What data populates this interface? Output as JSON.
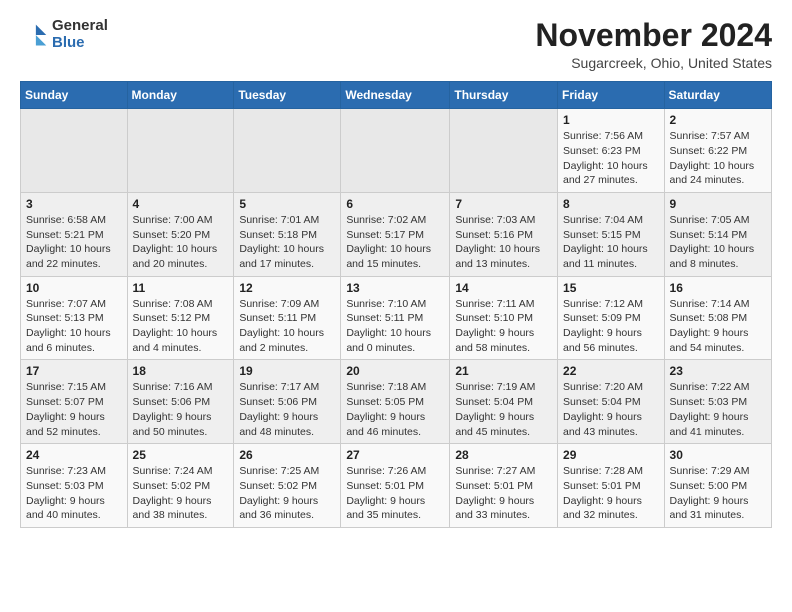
{
  "header": {
    "logo_general": "General",
    "logo_blue": "Blue",
    "month_title": "November 2024",
    "location": "Sugarcreek, Ohio, United States"
  },
  "days_of_week": [
    "Sunday",
    "Monday",
    "Tuesday",
    "Wednesday",
    "Thursday",
    "Friday",
    "Saturday"
  ],
  "weeks": [
    [
      {
        "day": "",
        "detail": ""
      },
      {
        "day": "",
        "detail": ""
      },
      {
        "day": "",
        "detail": ""
      },
      {
        "day": "",
        "detail": ""
      },
      {
        "day": "",
        "detail": ""
      },
      {
        "day": "1",
        "detail": "Sunrise: 7:56 AM\nSunset: 6:23 PM\nDaylight: 10 hours and 27 minutes."
      },
      {
        "day": "2",
        "detail": "Sunrise: 7:57 AM\nSunset: 6:22 PM\nDaylight: 10 hours and 24 minutes."
      }
    ],
    [
      {
        "day": "3",
        "detail": "Sunrise: 6:58 AM\nSunset: 5:21 PM\nDaylight: 10 hours and 22 minutes."
      },
      {
        "day": "4",
        "detail": "Sunrise: 7:00 AM\nSunset: 5:20 PM\nDaylight: 10 hours and 20 minutes."
      },
      {
        "day": "5",
        "detail": "Sunrise: 7:01 AM\nSunset: 5:18 PM\nDaylight: 10 hours and 17 minutes."
      },
      {
        "day": "6",
        "detail": "Sunrise: 7:02 AM\nSunset: 5:17 PM\nDaylight: 10 hours and 15 minutes."
      },
      {
        "day": "7",
        "detail": "Sunrise: 7:03 AM\nSunset: 5:16 PM\nDaylight: 10 hours and 13 minutes."
      },
      {
        "day": "8",
        "detail": "Sunrise: 7:04 AM\nSunset: 5:15 PM\nDaylight: 10 hours and 11 minutes."
      },
      {
        "day": "9",
        "detail": "Sunrise: 7:05 AM\nSunset: 5:14 PM\nDaylight: 10 hours and 8 minutes."
      }
    ],
    [
      {
        "day": "10",
        "detail": "Sunrise: 7:07 AM\nSunset: 5:13 PM\nDaylight: 10 hours and 6 minutes."
      },
      {
        "day": "11",
        "detail": "Sunrise: 7:08 AM\nSunset: 5:12 PM\nDaylight: 10 hours and 4 minutes."
      },
      {
        "day": "12",
        "detail": "Sunrise: 7:09 AM\nSunset: 5:11 PM\nDaylight: 10 hours and 2 minutes."
      },
      {
        "day": "13",
        "detail": "Sunrise: 7:10 AM\nSunset: 5:11 PM\nDaylight: 10 hours and 0 minutes."
      },
      {
        "day": "14",
        "detail": "Sunrise: 7:11 AM\nSunset: 5:10 PM\nDaylight: 9 hours and 58 minutes."
      },
      {
        "day": "15",
        "detail": "Sunrise: 7:12 AM\nSunset: 5:09 PM\nDaylight: 9 hours and 56 minutes."
      },
      {
        "day": "16",
        "detail": "Sunrise: 7:14 AM\nSunset: 5:08 PM\nDaylight: 9 hours and 54 minutes."
      }
    ],
    [
      {
        "day": "17",
        "detail": "Sunrise: 7:15 AM\nSunset: 5:07 PM\nDaylight: 9 hours and 52 minutes."
      },
      {
        "day": "18",
        "detail": "Sunrise: 7:16 AM\nSunset: 5:06 PM\nDaylight: 9 hours and 50 minutes."
      },
      {
        "day": "19",
        "detail": "Sunrise: 7:17 AM\nSunset: 5:06 PM\nDaylight: 9 hours and 48 minutes."
      },
      {
        "day": "20",
        "detail": "Sunrise: 7:18 AM\nSunset: 5:05 PM\nDaylight: 9 hours and 46 minutes."
      },
      {
        "day": "21",
        "detail": "Sunrise: 7:19 AM\nSunset: 5:04 PM\nDaylight: 9 hours and 45 minutes."
      },
      {
        "day": "22",
        "detail": "Sunrise: 7:20 AM\nSunset: 5:04 PM\nDaylight: 9 hours and 43 minutes."
      },
      {
        "day": "23",
        "detail": "Sunrise: 7:22 AM\nSunset: 5:03 PM\nDaylight: 9 hours and 41 minutes."
      }
    ],
    [
      {
        "day": "24",
        "detail": "Sunrise: 7:23 AM\nSunset: 5:03 PM\nDaylight: 9 hours and 40 minutes."
      },
      {
        "day": "25",
        "detail": "Sunrise: 7:24 AM\nSunset: 5:02 PM\nDaylight: 9 hours and 38 minutes."
      },
      {
        "day": "26",
        "detail": "Sunrise: 7:25 AM\nSunset: 5:02 PM\nDaylight: 9 hours and 36 minutes."
      },
      {
        "day": "27",
        "detail": "Sunrise: 7:26 AM\nSunset: 5:01 PM\nDaylight: 9 hours and 35 minutes."
      },
      {
        "day": "28",
        "detail": "Sunrise: 7:27 AM\nSunset: 5:01 PM\nDaylight: 9 hours and 33 minutes."
      },
      {
        "day": "29",
        "detail": "Sunrise: 7:28 AM\nSunset: 5:01 PM\nDaylight: 9 hours and 32 minutes."
      },
      {
        "day": "30",
        "detail": "Sunrise: 7:29 AM\nSunset: 5:00 PM\nDaylight: 9 hours and 31 minutes."
      }
    ]
  ]
}
